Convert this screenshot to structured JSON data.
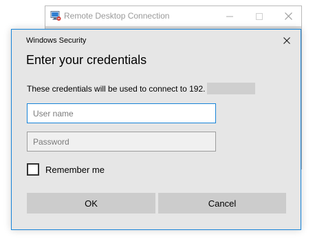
{
  "background_window": {
    "title": "Remote Desktop Connection",
    "app_icon": "remote-desktop-icon",
    "controls": [
      "minimize-icon",
      "maximize-icon",
      "close-icon"
    ]
  },
  "dialog": {
    "caption": "Windows Security",
    "close_icon": "close-icon",
    "heading": "Enter your credentials",
    "message": "These credentials will be used to connect to 192.",
    "message_redacted": true,
    "username": {
      "value": "",
      "placeholder": "User name"
    },
    "password": {
      "value": "",
      "placeholder": "Password"
    },
    "remember": {
      "label": "Remember me",
      "checked": false
    },
    "buttons": {
      "ok": "OK",
      "cancel": "Cancel"
    }
  },
  "colors": {
    "accent": "#1683d8",
    "dialog_bg": "#e6e6e6",
    "button_bg": "#cccccc",
    "redaction": "#cfcfcf"
  }
}
